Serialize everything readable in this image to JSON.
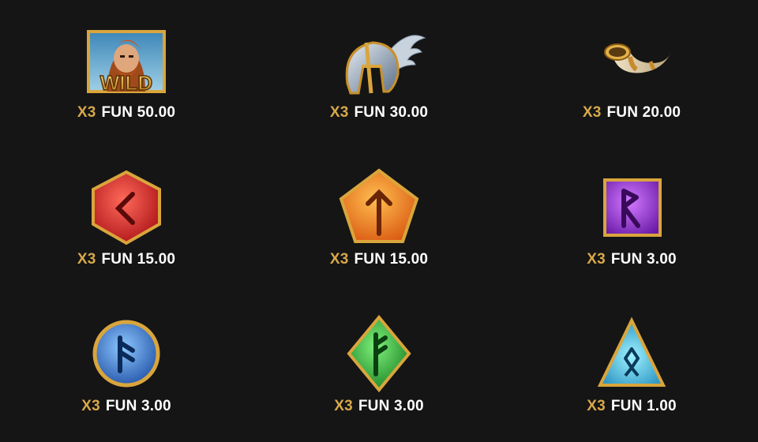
{
  "symbols": [
    {
      "id": "wild",
      "icon": "wild-viking-icon",
      "label": "WILD",
      "multiplier": "X3",
      "payout": "FUN 50.00"
    },
    {
      "id": "helmet",
      "icon": "winged-helmet-icon",
      "multiplier": "X3",
      "payout": "FUN 30.00"
    },
    {
      "id": "horn",
      "icon": "drinking-horn-icon",
      "multiplier": "X3",
      "payout": "FUN 20.00"
    },
    {
      "id": "red-rune",
      "icon": "red-hexagon-rune-icon",
      "multiplier": "X3",
      "payout": "FUN 15.00"
    },
    {
      "id": "orange-rune",
      "icon": "orange-pentagon-rune-icon",
      "multiplier": "X3",
      "payout": "FUN 15.00"
    },
    {
      "id": "purple-rune",
      "icon": "purple-square-rune-icon",
      "multiplier": "X3",
      "payout": "FUN 3.00"
    },
    {
      "id": "blue-rune",
      "icon": "blue-circle-rune-icon",
      "multiplier": "X3",
      "payout": "FUN 3.00"
    },
    {
      "id": "green-rune",
      "icon": "green-diamond-rune-icon",
      "multiplier": "X3",
      "payout": "FUN 3.00"
    },
    {
      "id": "cyan-rune",
      "icon": "cyan-triangle-rune-icon",
      "multiplier": "X3",
      "payout": "FUN 1.00"
    }
  ],
  "colors": {
    "background": "#151515",
    "multiplier": "#d8a84a",
    "amount": "#ffffff",
    "gold_frame": "#d9a53c"
  }
}
